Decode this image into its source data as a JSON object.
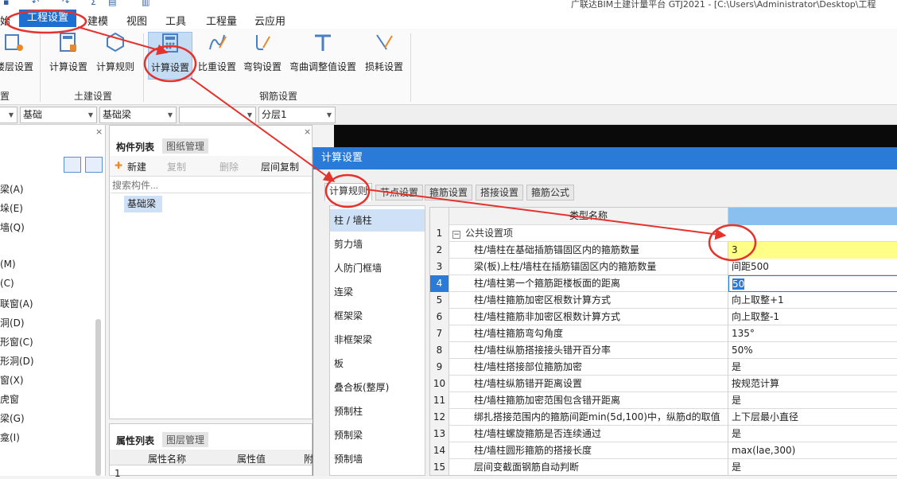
{
  "window": {
    "title": "广联达BIM土建计量平台 GTJ2021 - [C:\\Users\\Administrator\\Desktop\\工程"
  },
  "menu": {
    "partial_left": "始",
    "active": "工程设置",
    "items": [
      "建模",
      "视图",
      "工具",
      "工程量",
      "云应用"
    ]
  },
  "ribbon": {
    "partial_left_button": "楼层设置",
    "buttons_civil": [
      "计算设置",
      "计算规则"
    ],
    "buttons_rebar": [
      "计算设置",
      "比重设置",
      "弯钩设置",
      "弯曲调整值设置",
      "损耗设置"
    ],
    "group_partial": "置",
    "group_civil": "土建设置",
    "group_rebar": "钢筋设置"
  },
  "toolbar": {
    "dropdowns": [
      "基础",
      "基础梁",
      "",
      "分层1"
    ]
  },
  "left_panel": {
    "items": [
      "梁(A)",
      "垛(E)",
      "墙(Q)",
      "(M)",
      "(C)",
      "联窗(A)",
      "洞(D)",
      "形窗(C)",
      "形洞(D)",
      "窗(X)",
      "虎窗",
      "梁(G)",
      "龛(I)"
    ]
  },
  "component_panel": {
    "tab_active": "构件列表",
    "tab_other": "图纸管理",
    "actions": [
      "新建",
      "复制",
      "删除",
      "层间复制"
    ],
    "search_placeholder": "搜索构件...",
    "selected_item": "基础梁"
  },
  "property_panel": {
    "tab_active": "属性列表",
    "tab_other": "图层管理",
    "columns": [
      "属性名称",
      "属性值",
      "附"
    ],
    "first_row": "1"
  },
  "dialog": {
    "title": "计算设置",
    "tabs": [
      "计算规则",
      "节点设置",
      "箍筋设置",
      "搭接设置",
      "箍筋公式"
    ],
    "categories": [
      "柱 / 墙柱",
      "剪力墙",
      "人防门框墙",
      "连梁",
      "框架梁",
      "非框架梁",
      "板",
      "叠合板(整厚)",
      "预制柱",
      "预制梁",
      "预制墙"
    ],
    "grid_header": "类型名称",
    "group_label": "公共设置项",
    "rows": [
      {
        "n": "2",
        "name": "柱/墙柱在基础插筋锚固区内的箍筋数量",
        "value": "3"
      },
      {
        "n": "3",
        "name": "梁(板)上柱/墙柱在插筋锚固区内的箍筋数量",
        "value": "间距500"
      },
      {
        "n": "4",
        "name": "柱/墙柱第一个箍筋距楼板面的距离",
        "value": "50"
      },
      {
        "n": "5",
        "name": "柱/墙柱箍筋加密区根数计算方式",
        "value": "向上取整+1"
      },
      {
        "n": "6",
        "name": "柱/墙柱箍筋非加密区根数计算方式",
        "value": "向上取整-1"
      },
      {
        "n": "7",
        "name": "柱/墙柱箍筋弯勾角度",
        "value": "135°"
      },
      {
        "n": "8",
        "name": "柱/墙柱纵筋搭接接头错开百分率",
        "value": "50%"
      },
      {
        "n": "9",
        "name": "柱/墙柱搭接部位箍筋加密",
        "value": "是"
      },
      {
        "n": "10",
        "name": "柱/墙柱纵筋错开距离设置",
        "value": "按规范计算"
      },
      {
        "n": "11",
        "name": "柱/墙柱箍筋加密范围包含错开距离",
        "value": "是"
      },
      {
        "n": "12",
        "name": "绑扎搭接范围内的箍筋间距min(5d,100)中，纵筋d的取值",
        "value": "上下层最小直径"
      },
      {
        "n": "13",
        "name": "柱/墙柱螺旋箍筋是否连续通过",
        "value": "是"
      },
      {
        "n": "14",
        "name": "柱/墙柱圆形箍筋的搭接长度",
        "value": "max(lae,300)"
      },
      {
        "n": "15",
        "name": "层间变截面钢筋自动判断",
        "value": "是"
      }
    ]
  },
  "colors": {
    "accent": "#1e6fd0",
    "highlight_yellow": "#ffff88",
    "annotation": "#e5322d"
  }
}
